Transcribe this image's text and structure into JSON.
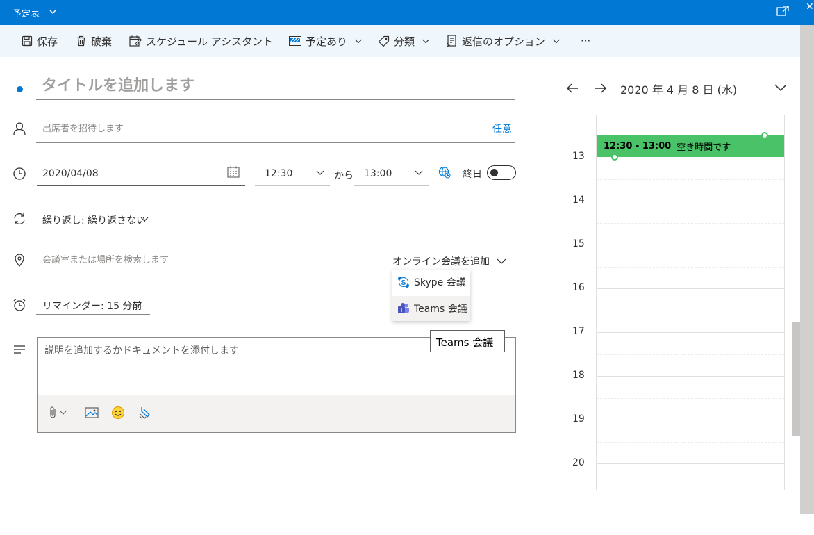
{
  "header": {
    "title": "予定表",
    "icons": [
      "chevron-down-icon",
      "popout-icon",
      "close-icon"
    ]
  },
  "toolbar": {
    "save": "保存",
    "discard": "破棄",
    "scheduling_assistant": "スケジュール アシスタント",
    "show_as": "予定あり",
    "categorize": "分類",
    "response_options": "返信のオプション",
    "more": "···"
  },
  "form": {
    "title_placeholder": "タイトルを追加します",
    "attendees_placeholder": "出席者を招待します",
    "optional": "任意",
    "date": "2020/04/08",
    "start_time": "12:30",
    "to": "から",
    "end_time": "13:00",
    "all_day": "終日",
    "all_day_on": false,
    "repeat": "繰り返し: 繰り返さない",
    "location_placeholder": "会議室または場所を検索します",
    "add_online_meeting": "オンライン会議を追加",
    "reminder": "リマインダー: 15 分前",
    "description_placeholder": "説明を追加するかドキュメントを添付します"
  },
  "online_meeting_menu": {
    "items": [
      "Skype 会議",
      "Teams 会議"
    ],
    "hovered": "Teams 会議",
    "tooltip": "Teams 会議"
  },
  "calendar": {
    "date_label": "2020 年 4 月 8 日 (水)",
    "hours": [
      "13",
      "14",
      "15",
      "16",
      "17",
      "18",
      "19",
      "20"
    ],
    "event": {
      "time": "12:30 - 13:00",
      "status": "空き時間です",
      "color": "#4ac368"
    }
  },
  "colors": {
    "brand": "#0078d4",
    "toolbar_bg": "#eff6fc"
  }
}
